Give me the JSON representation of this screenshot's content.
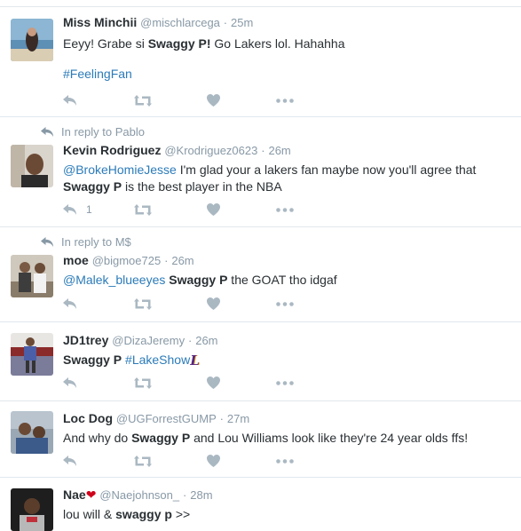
{
  "colors": {
    "link": "#2b7bb9",
    "muted": "#8899a6",
    "action_icon": "#aab8c2",
    "divider": "#e1e8ed",
    "heart_emoji": "#d0021b"
  },
  "tweets": [
    {
      "fullname": "Miss Minchii",
      "handle": "@mischlarcega",
      "dot": "·",
      "time": "25m",
      "text_pre": "Eeyy!  Grabe si ",
      "text_bold": "Swaggy P!",
      "text_post": "  Go Lakers lol. Hahahha",
      "hashtag": "#FeelingFan"
    },
    {
      "reply_context": "In reply to Pablo",
      "fullname": "Kevin Rodriguez",
      "handle": "@Krodriguez0623",
      "dot": "·",
      "time": "26m",
      "mention": "@BrokeHomieJesse",
      "text_line1": " I'm glad your a lakers fan maybe now you'll agree that",
      "text_bold": "Swaggy P",
      "text_line2": " is the best player in the NBA",
      "reply_count": "1"
    },
    {
      "reply_context": "In reply to M$",
      "fullname": "moe",
      "handle": "@bigmoe725",
      "dot": "·",
      "time": "26m",
      "mention": "@Malek_blueeyes",
      "text_bold": " Swaggy P",
      "text_post": " the GOAT tho idgaf"
    },
    {
      "fullname": "JD1trey",
      "handle": "@DizaJeremy",
      "dot": "·",
      "time": "26m",
      "text_bold": "Swaggy P",
      "hashtag": " #LakeShow",
      "team_logo_text": "L"
    },
    {
      "fullname": "Loc Dog",
      "handle": "@UGForrestGUMP",
      "dot": "·",
      "time": "27m",
      "text_pre": "And why do ",
      "text_bold": "Swaggy P",
      "text_post": " and Lou Williams look like they're 24 year olds ffs!"
    },
    {
      "fullname": "Nae",
      "fullname_emoji": "❤",
      "handle": "@Naejohnson_",
      "dot": "·",
      "time": "28m",
      "text_pre": "lou will & ",
      "text_bold": "swaggy p",
      "text_post": " >>"
    }
  ]
}
